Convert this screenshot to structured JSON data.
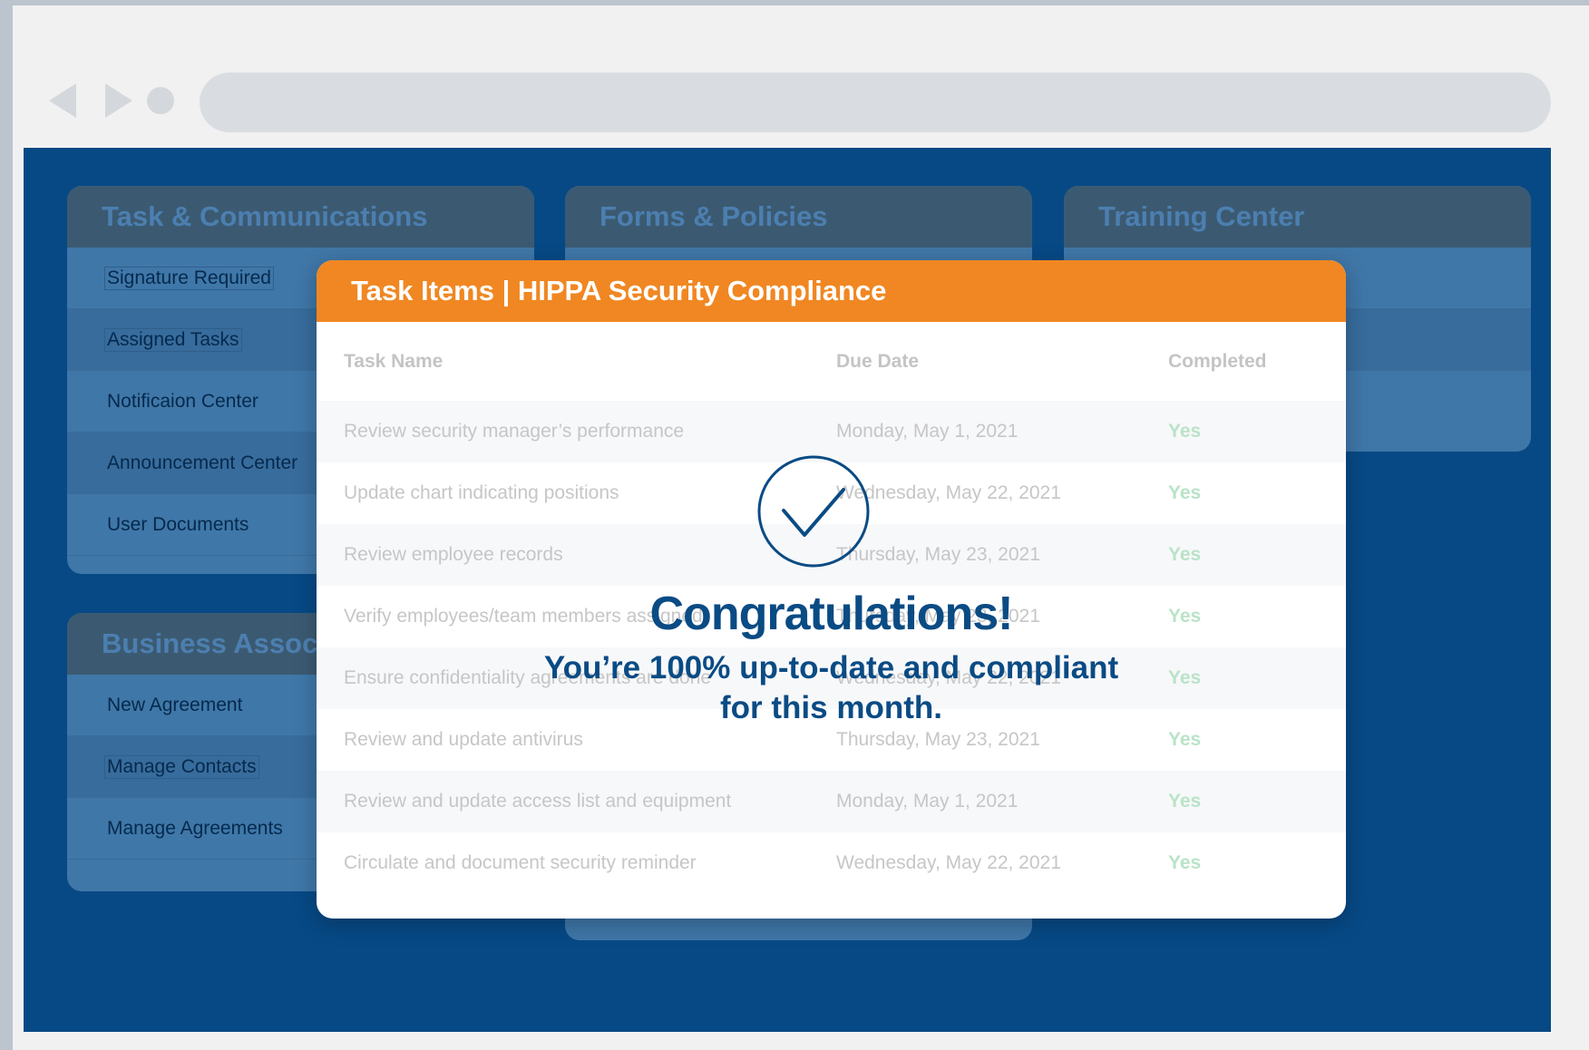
{
  "panels": {
    "tasks": {
      "title": "Task & Communications",
      "items": [
        "Signature Required",
        "Assigned Tasks",
        "Notificaion Center",
        "Announcement Center",
        "User Documents"
      ]
    },
    "forms": {
      "title": "Forms & Policies"
    },
    "training": {
      "title": "Training Center"
    },
    "business": {
      "title": "Business Associates",
      "items": [
        "New Agreement",
        "Manage Contacts",
        "Manage Agreements"
      ]
    }
  },
  "modal": {
    "title": "Task Items | HIPPA Security Compliance",
    "columns": [
      "Task Name",
      "Due Date",
      "Completed"
    ],
    "rows": [
      {
        "task": "Review security manager’s performance",
        "due": "Monday, May 1, 2021",
        "done": "Yes"
      },
      {
        "task": "Update chart indicating positions",
        "due": "Wednesday, May 22, 2021",
        "done": "Yes"
      },
      {
        "task": "Review employee records",
        "due": "Thursday, May 23, 2021",
        "done": "Yes"
      },
      {
        "task": "Verify employees/team members assigned",
        "due": "Thursday, May 23, 2021",
        "done": "Yes"
      },
      {
        "task": "Ensure confidentiality agreements are done",
        "due": "Wednesday, May 22, 2021",
        "done": "Yes"
      },
      {
        "task": "Review and update antivirus",
        "due": "Thursday, May 23, 2021",
        "done": "Yes"
      },
      {
        "task": "Review and update access list and equipment",
        "due": "Monday, May 1, 2021",
        "done": "Yes"
      },
      {
        "task": "Circulate and document security reminder",
        "due": "Wednesday, May 22, 2021",
        "done": "Yes"
      }
    ],
    "congrats": "Congratulations!",
    "subtitle_line1": "You’re 100% up-to-date and compliant",
    "subtitle_line2": "for this month."
  },
  "colors": {
    "app_background": "#074985",
    "modal_header": "#f08722",
    "accent_text": "#0a4b84",
    "completed": "#b9e3c7"
  }
}
